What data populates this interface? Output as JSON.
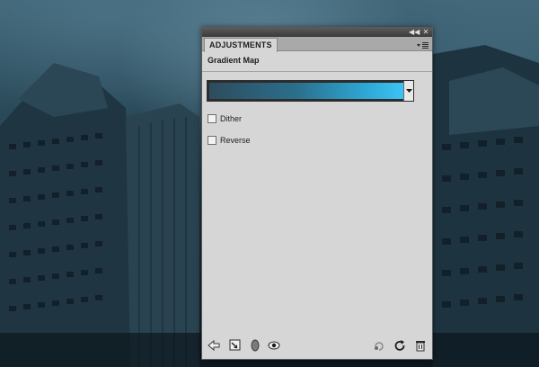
{
  "panel": {
    "tab_label": "ADJUSTMENTS",
    "heading": "Gradient Map",
    "gradient": {
      "start_color": "#2d4c5e",
      "end_color": "#3cc4f4"
    },
    "options": [
      {
        "label": "Dither",
        "checked": false
      },
      {
        "label": "Reverse",
        "checked": false
      }
    ],
    "titlebar_buttons": [
      "collapse-icon",
      "close-icon"
    ],
    "footer_icons": [
      "back-arrow-icon",
      "clip-to-layer-icon",
      "layer-visibility-circle-icon",
      "eye-icon",
      "view-previous-state-icon",
      "reset-icon",
      "trash-icon"
    ]
  },
  "colors": {
    "panel_bg": "#d6d6d6",
    "tab_strip": "#a9a9a9",
    "titlebar": "#3a3a3a"
  }
}
